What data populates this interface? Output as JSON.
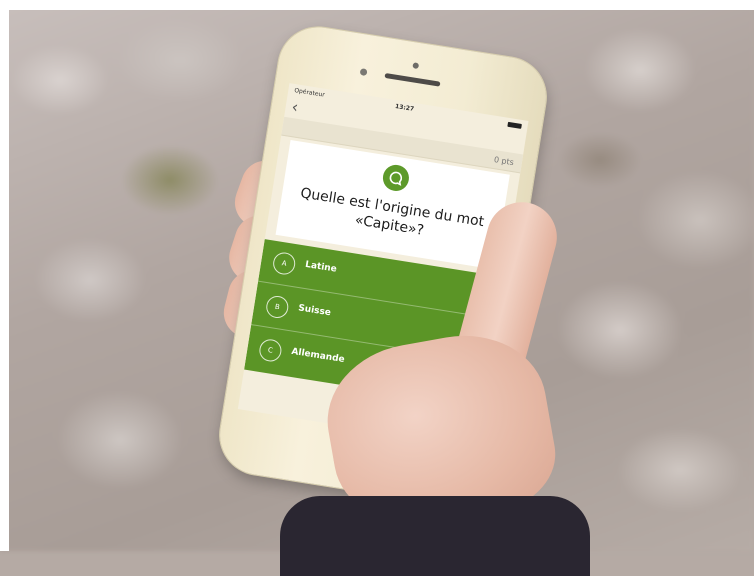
{
  "status_bar": {
    "carrier": "Opérateur",
    "time": "13:27"
  },
  "nav": {
    "back_icon": "chevron-left-icon"
  },
  "score": {
    "points": "0 pts"
  },
  "quiz": {
    "logo_icon": "speech-bubble-icon",
    "question": "Quelle est l'origine du mot «Capite»?"
  },
  "answers": [
    {
      "letter": "A",
      "label": "Latine"
    },
    {
      "letter": "B",
      "label": "Suisse"
    },
    {
      "letter": "C",
      "label": "Allemande"
    }
  ],
  "colors": {
    "accent_green": "#5b9526",
    "screen_bg": "#f4eedd"
  }
}
